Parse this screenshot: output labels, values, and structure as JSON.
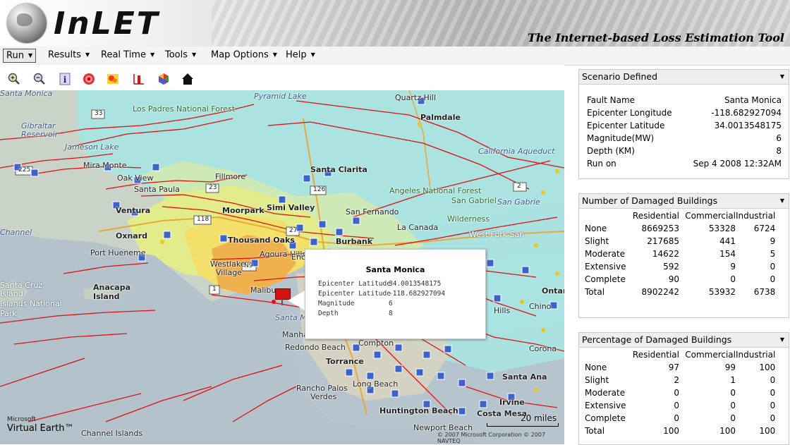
{
  "header": {
    "logo_text": "InLET",
    "tagline": "The Internet-based Loss Estimation Tool"
  },
  "menu": [
    {
      "label": "Run"
    },
    {
      "label": "Results"
    },
    {
      "label": "Real Time"
    },
    {
      "label": "Tools"
    },
    {
      "label": "Map Options"
    },
    {
      "label": "Help"
    }
  ],
  "toolbar_icons": [
    "zoom-in-icon",
    "zoom-out-icon",
    "info-icon",
    "target-icon",
    "heatmap-icon",
    "chart-icon",
    "color-wheel-icon",
    "house-icon"
  ],
  "map": {
    "labels": {
      "santa_monica_mountains": "Santa Monica",
      "pyramid_lake": "Pyramid Lake",
      "quartz_hill": "Quartz Hill",
      "palmdale": "Palmdale",
      "los_padres": "Los Padres National Forest",
      "gibraltar": "Gibraltar",
      "reservoir": "Reservoir",
      "jameson": "Jameson Lake",
      "california_aqueduct": "California Aqueduct",
      "mira_monte": "Mira Monte",
      "oak_view": "Oak View",
      "fillmore": "Fillmore",
      "santa_clarita": "Santa Clarita",
      "santa_paula": "Santa Paula",
      "angeles_nf": "Angeles National Forest",
      "ventura": "Ventura",
      "moorpark": "Moorpark",
      "simi_valley": "Simi Valley",
      "san_fernando": "San Fernando",
      "san_gabriel": "San Gabriel",
      "wilderness": "Wilderness",
      "channel": "Channel",
      "oxnard": "Oxnard",
      "thousand_oaks": "Thousand Oaks",
      "burbank": "Burbank",
      "la_canada": "La Canada",
      "west_fork": "West Fork San",
      "port_hueneme": "Port Hueneme",
      "agoura_hills": "Agoura Hills",
      "westlake": "Westlake",
      "village": "Village",
      "santa_cruz": "Santa Cruz",
      "island": "Island",
      "anacapa": "Anacapa",
      "islands_national": "Islands National",
      "park": "Park",
      "malibu": "Malibu",
      "santa_monica_bay": "Santa Monica",
      "manhattan": "Manhattan",
      "redondo": "Redondo Beach",
      "torrance": "Torrance",
      "rancho": "Rancho Palos",
      "verdes": "Verdes",
      "huntington": "Huntington Beach",
      "newport": "Newport Beach",
      "costa_mesa": "Costa Mesa",
      "irvine": "Irvine",
      "santa_ana": "Santa Ana",
      "corona": "Corona",
      "chino": "Chino",
      "ontario": "Ontario",
      "channel_islands": "Channel Islands",
      "long_beach": "Long Beach",
      "compton": "Compton",
      "encino": "Encino",
      "hills": "Hills",
      "san_gabriel_e": "San Gabrie"
    },
    "route_numbers": [
      "33",
      "225",
      "126",
      "23",
      "2",
      "118",
      "27",
      "1",
      "N9"
    ],
    "popup": {
      "title": "Santa Monica",
      "rows": [
        {
          "label": "Epicenter Latitude",
          "value": "34.0013548175"
        },
        {
          "label": "Epicenter Latitude",
          "value": "-118.682927094"
        },
        {
          "label": "Magnitude",
          "value": "6"
        },
        {
          "label": "Depth",
          "value": "8"
        }
      ]
    },
    "scale_label": "20 miles",
    "ms_brand": "Microsoft",
    "ms_product": "Virtual Earth™",
    "copyright": "© 2007 Microsoft Corporation  © 2007 NAVTEQ"
  },
  "scenario": {
    "title": "Scenario Defined",
    "rows": [
      {
        "label": "Fault Name",
        "value": "Santa Monica"
      },
      {
        "label": "Epicenter Longitude",
        "value": "-118.682927094"
      },
      {
        "label": "Epicenter Latitude",
        "value": "34.0013548175"
      },
      {
        "label": "Magnitude(MW)",
        "value": "6"
      },
      {
        "label": "Depth (KM)",
        "value": "8"
      },
      {
        "label": "Run on",
        "value": "Sep 4 2008 12:32AM"
      }
    ]
  },
  "damaged_count": {
    "title": "Number of Damaged Buildings",
    "columns": [
      "Residential",
      "Commercial",
      "Industrial"
    ],
    "rows": [
      {
        "label": "None",
        "values": [
          "8669253",
          "53328",
          "6724"
        ]
      },
      {
        "label": "Slight",
        "values": [
          "217685",
          "441",
          "9"
        ]
      },
      {
        "label": "Moderate",
        "values": [
          "14622",
          "154",
          "5"
        ]
      },
      {
        "label": "Extensive",
        "values": [
          "592",
          "9",
          "0"
        ]
      },
      {
        "label": "Complete",
        "values": [
          "90",
          "0",
          "0"
        ]
      },
      {
        "label": "Total",
        "values": [
          "8902242",
          "53932",
          "6738"
        ]
      }
    ]
  },
  "damaged_pct": {
    "title": "Percentage of Damaged Buildings",
    "columns": [
      "Residential",
      "Commercial",
      "Industrial"
    ],
    "rows": [
      {
        "label": "None",
        "values": [
          "97",
          "99",
          "100"
        ]
      },
      {
        "label": "Slight",
        "values": [
          "2",
          "1",
          "0"
        ]
      },
      {
        "label": "Moderate",
        "values": [
          "0",
          "0",
          "0"
        ]
      },
      {
        "label": "Extensive",
        "values": [
          "0",
          "0",
          "0"
        ]
      },
      {
        "label": "Complete",
        "values": [
          "0",
          "0",
          "0"
        ]
      },
      {
        "label": "Total",
        "values": [
          "100",
          "100",
          "100"
        ]
      }
    ]
  }
}
